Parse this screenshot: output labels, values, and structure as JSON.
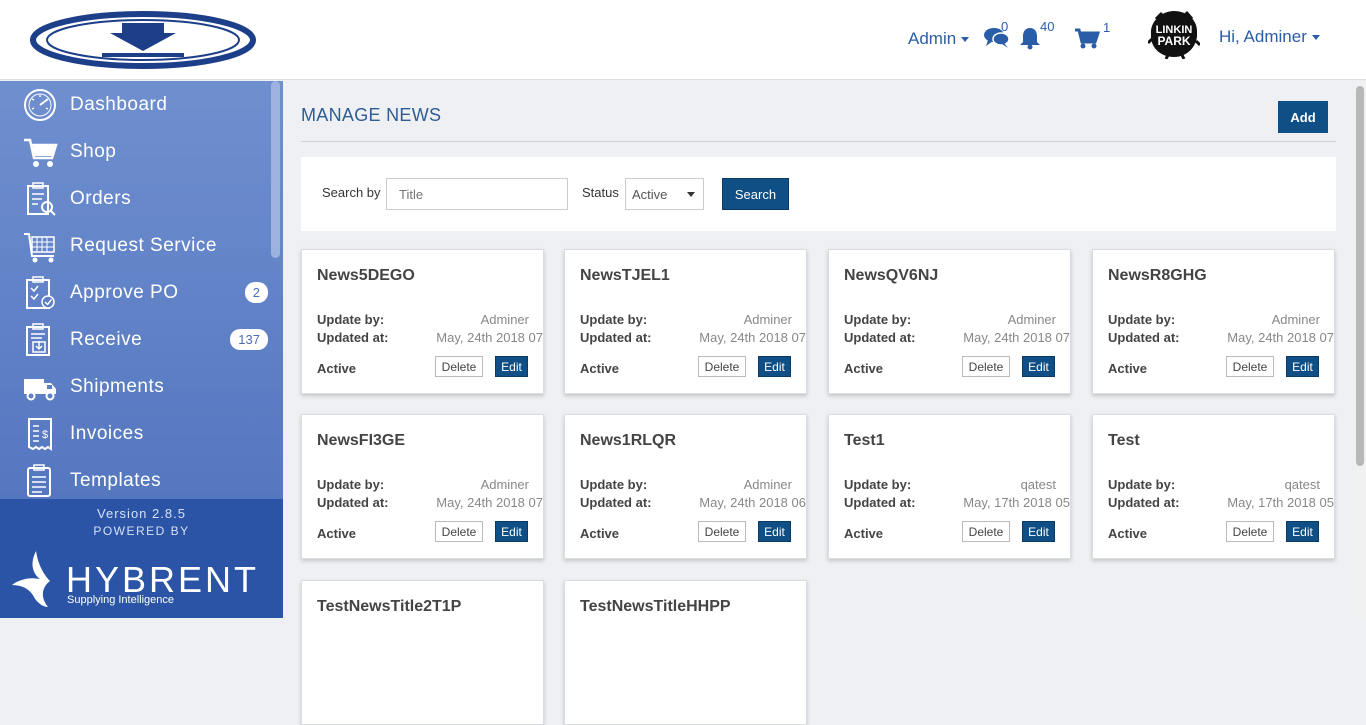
{
  "header": {
    "admin_menu": "Admin",
    "messages_count": "0",
    "notifications_count": "40",
    "cart_count": "1",
    "user_greeting": "Hi, Adminer"
  },
  "sidebar": {
    "items": [
      {
        "label": "Dashboard",
        "icon": "dashboard-gauge-icon"
      },
      {
        "label": "Shop",
        "icon": "cart-icon"
      },
      {
        "label": "Orders",
        "icon": "orders-clipboard-icon"
      },
      {
        "label": "Request Service",
        "icon": "request-service-icon"
      },
      {
        "label": "Approve PO",
        "icon": "approve-po-icon",
        "badge": "2"
      },
      {
        "label": "Receive",
        "icon": "receive-icon",
        "badge": "137"
      },
      {
        "label": "Shipments",
        "icon": "truck-icon"
      },
      {
        "label": "Invoices",
        "icon": "invoice-icon"
      },
      {
        "label": "Templates",
        "icon": "templates-icon"
      }
    ],
    "version": "Version 2.8.5",
    "powered_by": "POWERED BY",
    "brand": "HYBRENT",
    "tagline": "Supplying Intelligence"
  },
  "main": {
    "title": "MANAGE NEWS",
    "add_label": "Add",
    "filter": {
      "search_by_label": "Search by",
      "search_placeholder": "Title",
      "status_label": "Status",
      "status_value": "Active",
      "search_button": "Search"
    },
    "labels": {
      "updated_by": "Update by:",
      "updated_at": "Updated at:",
      "delete": "Delete",
      "edit": "Edit"
    },
    "cards": [
      {
        "title": "News5DEGO",
        "by": "Adminer",
        "at": "May, 24th 2018 07",
        "status": "Active"
      },
      {
        "title": "NewsTJEL1",
        "by": "Adminer",
        "at": "May, 24th 2018 07",
        "status": "Active"
      },
      {
        "title": "NewsQV6NJ",
        "by": "Adminer",
        "at": "May, 24th 2018 07",
        "status": "Active"
      },
      {
        "title": "NewsR8GHG",
        "by": "Adminer",
        "at": "May, 24th 2018 07",
        "status": "Active"
      },
      {
        "title": "NewsFI3GE",
        "by": "Adminer",
        "at": "May, 24th 2018 07",
        "status": "Active"
      },
      {
        "title": "News1RLQR",
        "by": "Adminer",
        "at": "May, 24th 2018 06",
        "status": "Active"
      },
      {
        "title": "Test1",
        "by": "qatest",
        "at": "May, 17th 2018 05",
        "status": "Active"
      },
      {
        "title": "Test",
        "by": "qatest",
        "at": "May, 17th 2018 05",
        "status": "Active"
      },
      {
        "title": "TestNewsTitle2T1P"
      },
      {
        "title": "TestNewsTitleHHPP"
      }
    ]
  },
  "colors": {
    "accent": "#0f4f86",
    "sidebar": "#5f80c6",
    "sidebar_footer": "#2b54a6",
    "link": "#2a5da8"
  }
}
